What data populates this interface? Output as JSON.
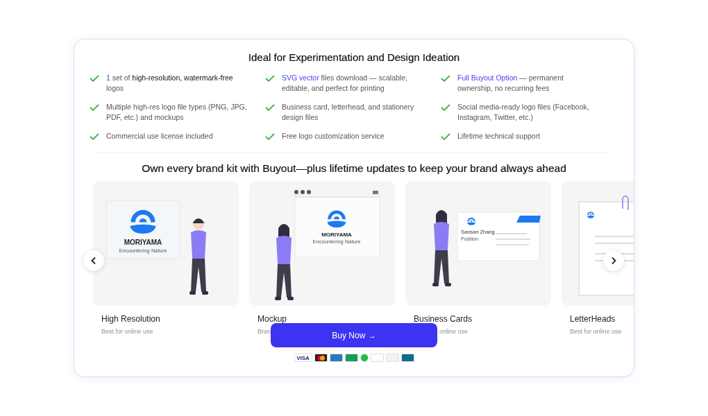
{
  "features_title": "Ideal for Experimentation and Design Ideation",
  "features": [
    {
      "text": "*1* set of **high-resolution, watermark-free** logos"
    },
    {
      "text": "*SVG vector* files download — scalable, editable, and perfect for printing"
    },
    {
      "text": "*Full Buyout Option* — permanent ownership, no recurring fees"
    },
    {
      "text": "Multiple high-res logo file types (PNG, JPG, PDF, etc.) and mockups"
    },
    {
      "text": "Business card, letterhead, and stationery design files"
    },
    {
      "text": "Social media-ready logo files (Facebook, Instagram, Twitter, etc.)"
    },
    {
      "text": "Commercial use license included"
    },
    {
      "text": "Free logo customization service"
    },
    {
      "text": "Lifetime technical support"
    }
  ],
  "kits_title": "Own every brand kit with Buyout—plus lifetime updates to keep your brand always ahead",
  "kits": [
    {
      "kind": "logo",
      "title": "High Resolution",
      "subtitle": "Best for online use",
      "logo_name": "MORIYAMA",
      "logo_tagline": "Encountering Nature"
    },
    {
      "kind": "mockup",
      "title": "Mockup",
      "subtitle": "Bran",
      "logo_name": "MORIYAMA",
      "logo_tagline": "Encountering Nature"
    },
    {
      "kind": "business-card",
      "title": "Business Cards",
      "subtitle": "online use",
      "person_name": "Sansan Zhang",
      "person_role": "Position"
    },
    {
      "kind": "letterhead",
      "title": "LetterHeads",
      "subtitle": "Best for online use"
    }
  ],
  "buy_button": "Buy Now →",
  "payment_methods": [
    {
      "kind": "visa",
      "label": "VISA"
    },
    {
      "kind": "mastercard"
    },
    {
      "kind": "amex"
    },
    {
      "kind": "jcb"
    },
    {
      "kind": "play"
    },
    {
      "kind": "discover"
    },
    {
      "kind": "diners"
    },
    {
      "kind": "unionpay"
    }
  ]
}
